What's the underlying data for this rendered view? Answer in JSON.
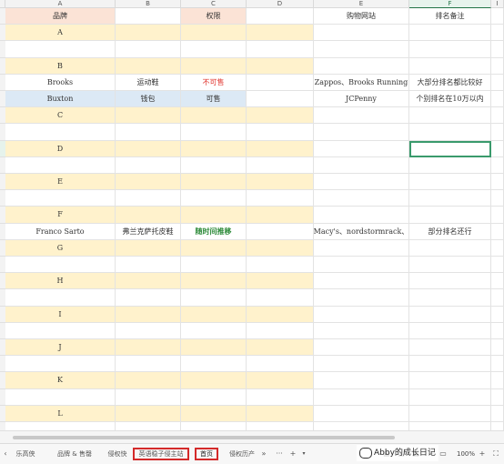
{
  "columns": [
    "A",
    "B",
    "C",
    "D",
    "E",
    "F",
    "I"
  ],
  "selected_column": "F",
  "row_numbers": [
    "",
    "",
    "",
    "",
    "",
    "",
    "",
    "",
    "",
    "",
    "",
    "",
    "",
    "",
    "",
    "",
    "",
    "",
    "",
    "",
    "",
    "",
    "",
    "",
    "",
    ""
  ],
  "header_row": [
    "品牌",
    "",
    "权限",
    "",
    "购物网站",
    "排名备注"
  ],
  "rows": [
    {
      "type": "header",
      "cells": [
        "品牌",
        "",
        "权限",
        "",
        "购物网站",
        "排名备注"
      ]
    },
    {
      "type": "letter",
      "cells": [
        "A",
        "",
        "",
        "",
        "",
        ""
      ]
    },
    {
      "type": "blank",
      "cells": [
        "",
        "",
        "",
        "",
        "",
        ""
      ]
    },
    {
      "type": "letter",
      "cells": [
        "B",
        "",
        "",
        "",
        "",
        ""
      ]
    },
    {
      "type": "brand",
      "cells": [
        "Brooks",
        "运动鞋",
        "不可售",
        "",
        "Zappos、Brooks Running",
        "大部分排名都比较好"
      ],
      "c_style": "red"
    },
    {
      "type": "brand-blue",
      "cells": [
        "Buxton",
        "钱包",
        "可售",
        "",
        "JCPenny",
        "个别排名在10万以内"
      ]
    },
    {
      "type": "letter",
      "cells": [
        "C",
        "",
        "",
        "",
        "",
        ""
      ]
    },
    {
      "type": "blank",
      "cells": [
        "",
        "",
        "",
        "",
        "",
        ""
      ]
    },
    {
      "type": "letter",
      "cells": [
        "D",
        "",
        "",
        "",
        "",
        ""
      ]
    },
    {
      "type": "blank",
      "cells": [
        "",
        "",
        "",
        "",
        "",
        ""
      ]
    },
    {
      "type": "letter",
      "cells": [
        "E",
        "",
        "",
        "",
        "",
        ""
      ]
    },
    {
      "type": "blank",
      "cells": [
        "",
        "",
        "",
        "",
        "",
        ""
      ]
    },
    {
      "type": "letter",
      "cells": [
        "F",
        "",
        "",
        "",
        "",
        ""
      ]
    },
    {
      "type": "brand",
      "cells": [
        "Franco Sarto",
        "弗兰克萨托皮鞋",
        "随时间推移",
        "",
        "Macy's、nordstormrack、",
        "部分排名还行"
      ],
      "c_style": "green"
    },
    {
      "type": "letter",
      "cells": [
        "G",
        "",
        "",
        "",
        "",
        ""
      ]
    },
    {
      "type": "blank",
      "cells": [
        "",
        "",
        "",
        "",
        "",
        ""
      ]
    },
    {
      "type": "letter",
      "cells": [
        "H",
        "",
        "",
        "",
        "",
        ""
      ]
    },
    {
      "type": "blank",
      "cells": [
        "",
        "",
        "",
        "",
        "",
        ""
      ]
    },
    {
      "type": "letter",
      "cells": [
        "I",
        "",
        "",
        "",
        "",
        ""
      ]
    },
    {
      "type": "blank",
      "cells": [
        "",
        "",
        "",
        "",
        "",
        ""
      ]
    },
    {
      "type": "letter",
      "cells": [
        "J",
        "",
        "",
        "",
        "",
        ""
      ]
    },
    {
      "type": "blank",
      "cells": [
        "",
        "",
        "",
        "",
        "",
        ""
      ]
    },
    {
      "type": "letter",
      "cells": [
        "K",
        "",
        "",
        "",
        "",
        ""
      ]
    },
    {
      "type": "blank",
      "cells": [
        "",
        "",
        "",
        "",
        "",
        ""
      ]
    },
    {
      "type": "letter",
      "cells": [
        "L",
        "",
        "",
        "",
        "",
        ""
      ]
    },
    {
      "type": "blank",
      "cells": [
        "",
        "",
        "",
        "",
        "",
        ""
      ]
    }
  ],
  "sheet_tabs": [
    {
      "label": "乐高侠",
      "highlight": false
    },
    {
      "label": "品牌 & 售罄",
      "highlight": false
    },
    {
      "label": "侵权快",
      "highlight": false
    },
    {
      "label": "英语稳子侵主站",
      "highlight": true
    },
    {
      "label": "首页",
      "highlight": true
    },
    {
      "label": "侵权历产",
      "highlight": false
    }
  ],
  "sheet_controls": {
    "more": "»",
    "dots": "···",
    "add": "+",
    "menu": "▾"
  },
  "zoom": "100%",
  "zoom_minus": "−",
  "zoom_plus": "+",
  "watermark": "Abby的成长日记",
  "colors": {
    "peach": "#fbe3d6",
    "yellow": "#fff2cc",
    "blue": "#dce9f5",
    "selected": "#217346",
    "highlight_border": "#d42a2a"
  }
}
